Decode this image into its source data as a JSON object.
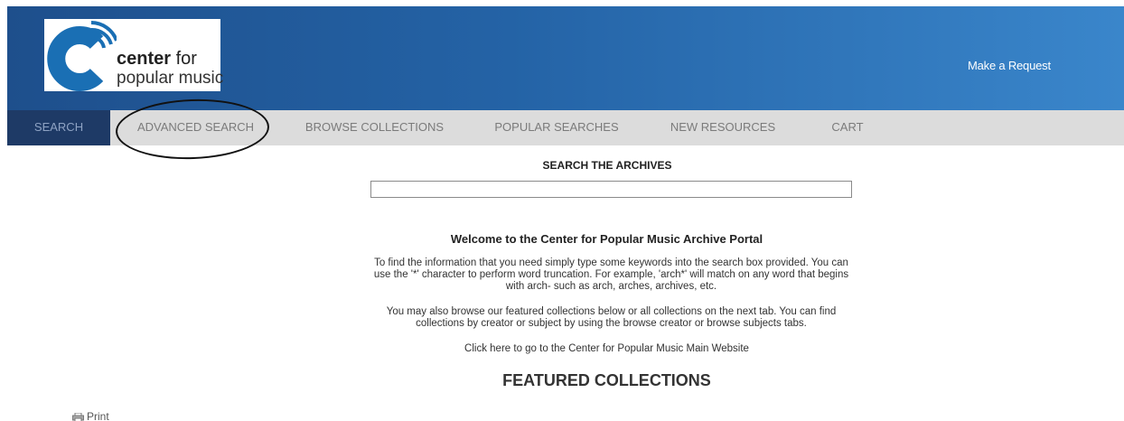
{
  "header": {
    "logo": {
      "line1_bold": "center",
      "line1_rest": " for",
      "line2": "popular music"
    },
    "request_link": "Make a Request",
    "colors": {
      "gradient_start": "#1e4f8c",
      "gradient_end": "#3a86cb"
    }
  },
  "nav": {
    "items": [
      {
        "label": "SEARCH",
        "active": true
      },
      {
        "label": "ADVANCED SEARCH",
        "active": false
      },
      {
        "label": "BROWSE COLLECTIONS",
        "active": false
      },
      {
        "label": "POPULAR SEARCHES",
        "active": false
      },
      {
        "label": "NEW RESOURCES",
        "active": false
      },
      {
        "label": "CART",
        "active": false
      }
    ],
    "colors": {
      "bar": "#dcdcdc",
      "active_bg": "#1e3a66"
    }
  },
  "search": {
    "title": "SEARCH THE ARCHIVES",
    "value": "",
    "placeholder": ""
  },
  "welcome": {
    "title": "Welcome to the Center for Popular Music Archive Portal",
    "paragraph1": "To find the information that you need simply type some keywords into the search box provided. You can use the '*' character to perform word truncation. For example, 'arch*' will match on any word that begins with arch- such as arch, arches, archives, etc.",
    "paragraph2": "You may also browse our featured collections below or all collections on the next tab. You can find collections by creator or subject by using the browse creator or browse subjects tabs.",
    "main_site_link": "Click here to go to the Center for Popular Music Main Website"
  },
  "featured": {
    "title": "FEATURED COLLECTIONS"
  },
  "footer": {
    "print_label": "Print",
    "print_icon": "printer-icon"
  }
}
